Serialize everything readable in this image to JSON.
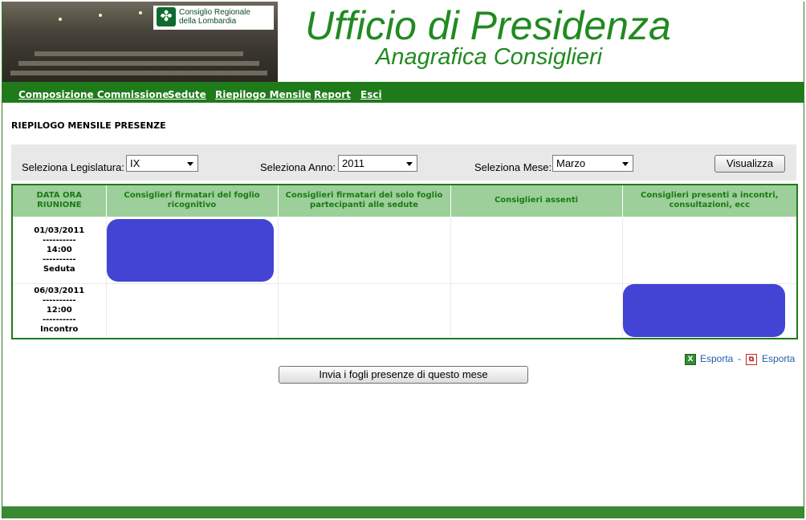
{
  "header": {
    "logo_line1": "Consiglio Regionale",
    "logo_line2": "della Lombardia",
    "title": "Ufficio di Presidenza",
    "subtitle": "Anagrafica Consiglieri"
  },
  "nav": {
    "items": [
      {
        "label": "Composizione Commissione"
      },
      {
        "label": "Sedute"
      },
      {
        "label": "Riepilogo Mensile"
      },
      {
        "label": "Report"
      },
      {
        "label": "Esci"
      }
    ]
  },
  "page": {
    "section_title": "RIEPILOGO MENSILE PRESENZE"
  },
  "filters": {
    "legislatura_label": "Seleziona Legislatura:",
    "legislatura_value": "IX",
    "anno_label": "Seleziona Anno:",
    "anno_value": "2011",
    "mese_label": "Seleziona Mese:",
    "mese_value": "Marzo",
    "visualizza_label": "Visualizza"
  },
  "table": {
    "headers": [
      "DATA ORA RIUNIONE",
      "Consiglieri firmatari del foglio ricognitivo",
      "Consiglieri firmatari del solo foglio partecipanti alle sedute",
      "Consiglieri assenti",
      "Consiglieri presenti a incontri, consultazioni, ecc"
    ],
    "rows": [
      {
        "date": "01/03/2011",
        "sep": "----------",
        "time": "14:00",
        "type": "Seduta"
      },
      {
        "date": "06/03/2011",
        "sep": "----------",
        "time": "12:00",
        "type": "Incontro"
      }
    ]
  },
  "export": {
    "xls_label": "Esporta",
    "separator": "-",
    "pdf_label": "Esporta"
  },
  "actions": {
    "send_label": "Invia i fogli presenze di questo mese"
  },
  "colors": {
    "brand_green": "#1f7a1a",
    "title_green": "#218a21",
    "header_cell_bg": "#9ccf99",
    "redaction": "#4444d4"
  }
}
